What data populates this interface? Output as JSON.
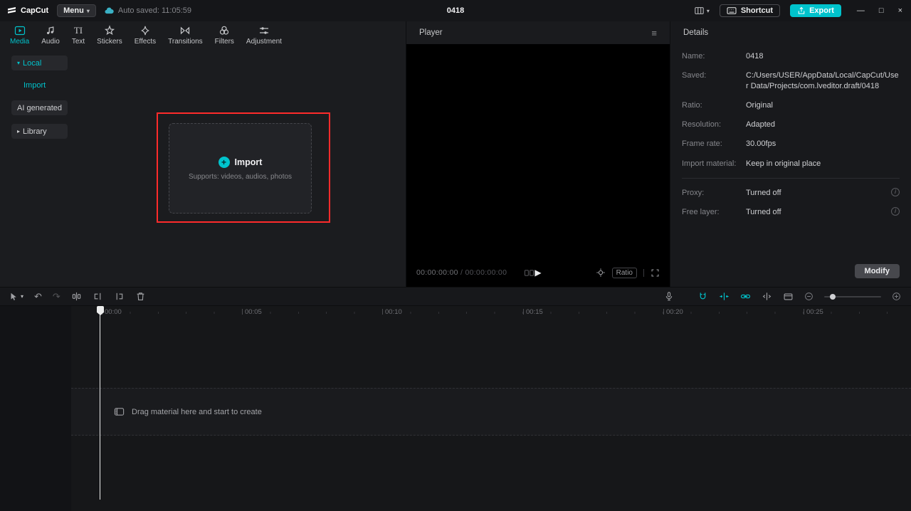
{
  "titlebar": {
    "app_name": "CapCut",
    "menu_label": "Menu",
    "autosave_text": "Auto saved: 11:05:59",
    "project_title": "0418",
    "shortcut_label": "Shortcut",
    "export_label": "Export"
  },
  "media_panel": {
    "tabs": [
      {
        "label": "Media"
      },
      {
        "label": "Audio"
      },
      {
        "label": "Text"
      },
      {
        "label": "Stickers"
      },
      {
        "label": "Effects"
      },
      {
        "label": "Transitions"
      },
      {
        "label": "Filters"
      },
      {
        "label": "Adjustment"
      }
    ],
    "sidebar": {
      "local": "Local",
      "import": "Import",
      "ai_generated": "AI generated",
      "library": "Library"
    },
    "import_box": {
      "title": "Import",
      "subtitle": "Supports: videos, audios, photos"
    }
  },
  "player": {
    "title": "Player",
    "current_time": "00:00:00:00",
    "separator": " / ",
    "total_time": "00:00:00:00",
    "ratio_label": "Ratio"
  },
  "details": {
    "title": "Details",
    "rows": [
      {
        "label": "Name:",
        "value": "0418"
      },
      {
        "label": "Saved:",
        "value": "C:/Users/USER/AppData/Local/CapCut/User Data/Projects/com.lveditor.draft/0418"
      },
      {
        "label": "Ratio:",
        "value": "Original"
      },
      {
        "label": "Resolution:",
        "value": "Adapted"
      },
      {
        "label": "Frame rate:",
        "value": "30.00fps"
      },
      {
        "label": "Import material:",
        "value": "Keep in original place"
      }
    ],
    "toggles": [
      {
        "label": "Proxy:",
        "value": "Turned off"
      },
      {
        "label": "Free layer:",
        "value": "Turned off"
      }
    ],
    "modify_label": "Modify"
  },
  "timeline": {
    "ticks": [
      "00:00",
      "00:05",
      "00:10",
      "00:15",
      "00:20",
      "00:25"
    ],
    "empty_hint": "Drag material here and start to create"
  },
  "icons": {
    "chevron_down": "▾",
    "chevron_right": "▸",
    "hamburger": "≡",
    "play": "▶",
    "undo": "↶",
    "redo": "↷",
    "plus": "+",
    "info": "i",
    "minimize": "—",
    "maximize": "□",
    "close": "×"
  },
  "colors": {
    "accent": "#00c3cc",
    "annotation_red": "#ff2b2b"
  }
}
